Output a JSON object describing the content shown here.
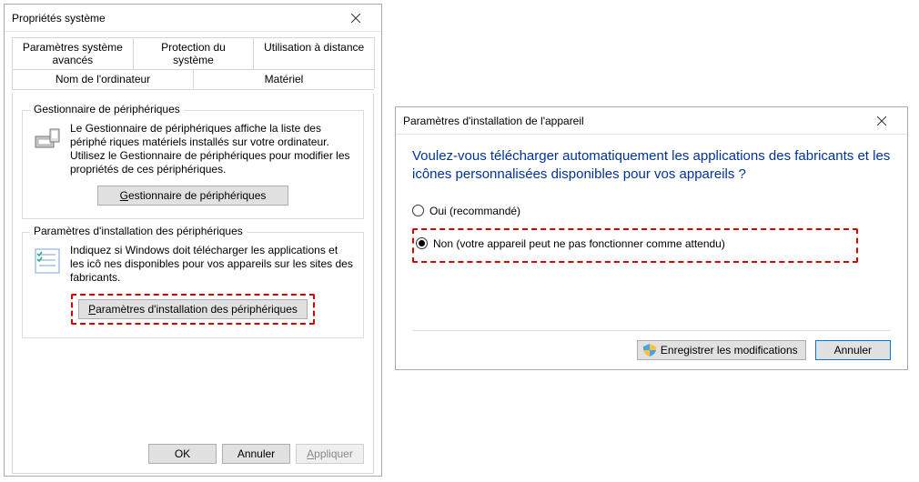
{
  "window1": {
    "title": "Propriétés système",
    "tabs": {
      "row1": [
        "Paramètres système avancés",
        "Protection du système",
        "Utilisation à distance"
      ],
      "row2": [
        "Nom de l'ordinateur",
        "Matériel"
      ],
      "active": "Matériel"
    },
    "group1": {
      "legend": "Gestionnaire de périphériques",
      "text": "Le Gestionnaire de périphériques affiche la liste des périphé riques matériels installés sur votre ordinateur. Utilisez le Gestionnaire de périphériques pour modifier les propriétés de ces périphériques.",
      "button_accel": "G",
      "button_rest": "estionnaire de périphériques"
    },
    "group2": {
      "legend": "Paramètres d'installation des périphériques",
      "text": "Indiquez si Windows doit télécharger les applications et les icô nes disponibles pour vos appareils sur les sites des fabricants.",
      "button_accel": "P",
      "button_rest": "aramètres d'installation des périphériques"
    },
    "footer": {
      "ok": "OK",
      "cancel": "Annuler",
      "apply_accel": "A",
      "apply_rest": "ppliquer"
    }
  },
  "window2": {
    "title": "Paramètres d'installation de l'appareil",
    "question": "Voulez-vous télécharger automatiquement les applications des fabricants et les icônes personnalisées disponibles pour vos appareils ?",
    "option_yes": "Oui (recommandé)",
    "option_no": "Non (votre appareil peut ne pas fonctionner comme attendu)",
    "selected": "no",
    "footer": {
      "save": "Enregistrer les modifications",
      "cancel": "Annuler"
    }
  }
}
